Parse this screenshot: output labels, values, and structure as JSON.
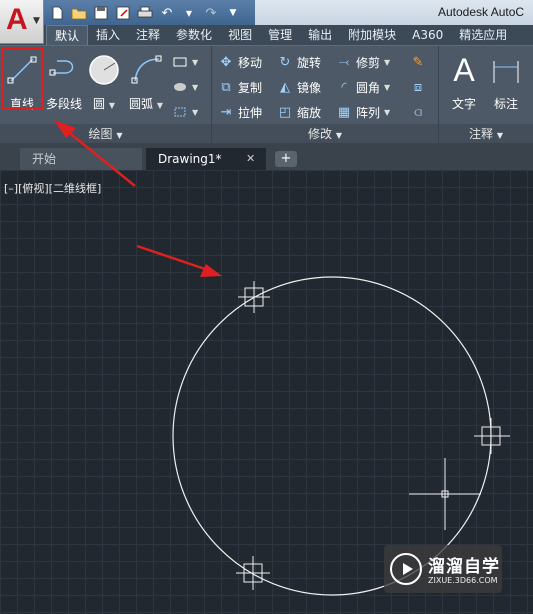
{
  "app": {
    "title": "Autodesk AutoC",
    "logo_letter": "A",
    "qat_icons": [
      "new-file-icon",
      "open-folder-icon",
      "save-icon",
      "save-as-icon",
      "print-icon",
      "undo-icon",
      "redo-icon",
      "customize-qat-icon"
    ]
  },
  "ribbon_tabs": [
    "默认",
    "插入",
    "注释",
    "参数化",
    "视图",
    "管理",
    "输出",
    "附加模块",
    "A360",
    "精选应用"
  ],
  "active_tab": "默认",
  "panels": {
    "draw": {
      "title": "绘图",
      "tools": [
        {
          "label": "直线",
          "icon": "line-icon"
        },
        {
          "label": "多段线",
          "icon": "polyline-icon"
        },
        {
          "label": "圆",
          "icon": "circle-icon"
        },
        {
          "label": "圆弧",
          "icon": "arc-icon"
        }
      ]
    },
    "modify": {
      "title": "修改",
      "tools": [
        {
          "label": "移动",
          "icon": "move-icon"
        },
        {
          "label": "旋转",
          "icon": "rotate-icon"
        },
        {
          "label": "修剪",
          "icon": "trim-icon"
        },
        {
          "label": "复制",
          "icon": "copy-icon"
        },
        {
          "label": "镜像",
          "icon": "mirror-icon"
        },
        {
          "label": "圆角",
          "icon": "fillet-icon"
        },
        {
          "label": "拉伸",
          "icon": "stretch-icon"
        },
        {
          "label": "缩放",
          "icon": "scale-icon"
        },
        {
          "label": "阵列",
          "icon": "array-icon"
        }
      ]
    },
    "annotation": {
      "title": "注释",
      "tools": [
        {
          "label": "文字",
          "icon": "text-icon"
        },
        {
          "label": "标注",
          "icon": "dimension-icon"
        }
      ]
    }
  },
  "document_tabs": [
    {
      "label": "开始",
      "active": false
    },
    {
      "label": "Drawing1*",
      "active": true
    }
  ],
  "viewport_label": "[–][俯视][二维线框]",
  "colors": {
    "canvas_bg": "#212830",
    "ribbon_bg": "#4d5966",
    "highlight": "#e02020",
    "logo_red": "#c4161c"
  },
  "watermark": {
    "name": "溜溜自学",
    "url": "ZIXUE.3D66.COM"
  }
}
